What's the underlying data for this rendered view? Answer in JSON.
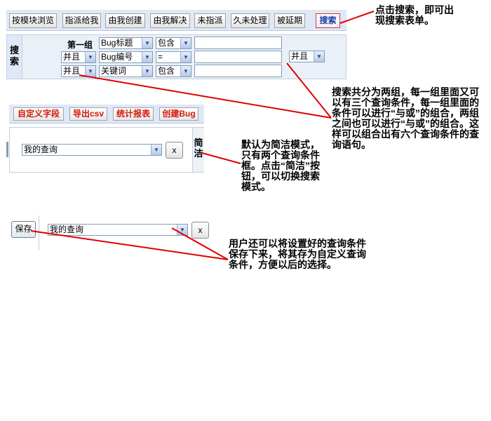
{
  "toolbar": {
    "buttons": [
      "按模块浏览",
      "指派给我",
      "由我创建",
      "由我解决",
      "未指派",
      "久未处理",
      "被延期"
    ],
    "search_label": "搜索"
  },
  "search_form": {
    "side_label": "搜索",
    "group_label": "第一组",
    "rows": [
      {
        "logic": "",
        "field": "Bug标题",
        "operator": "包含"
      },
      {
        "logic": "并且",
        "field": "Bug编号",
        "operator": "="
      },
      {
        "logic": "并且",
        "field": "关键词",
        "operator": "包含"
      }
    ],
    "group_logic": "并且"
  },
  "toolbar2": {
    "buttons": [
      "自定义字段",
      "导出csv",
      "统计报表",
      "创建Bug"
    ]
  },
  "simple_query": {
    "select_value": "我的查询",
    "clear_label": "x",
    "toggle_label": "简洁"
  },
  "save_row": {
    "save_label": "保存",
    "select_value": "我的查询",
    "clear_label": "x"
  },
  "annotations": {
    "search_note": "点击搜索，即可出现搜索表单。",
    "groups_note": "搜索共分为两组，每一组里面又可以有三个查询条件，每一组里面的条件可以进行“与或”的组合，两组之间也可以进行“与或”的组合。这样可以组合出有六个查询条件的查询语句。",
    "simple_note": "默认为简洁模式，只有两个查询条件框。点击“简洁”按钮，可以切换搜索模式。",
    "save_note": "用户还可以将设置好的查询条件保存下来，将其存为自定义查询条件，方便以后的选择。"
  },
  "colors": {
    "toolbar_bg": "#dfe8f6",
    "accent_red": "#e0352b",
    "arrow_red": "#e00000",
    "link_blue": "#1a3da8"
  }
}
